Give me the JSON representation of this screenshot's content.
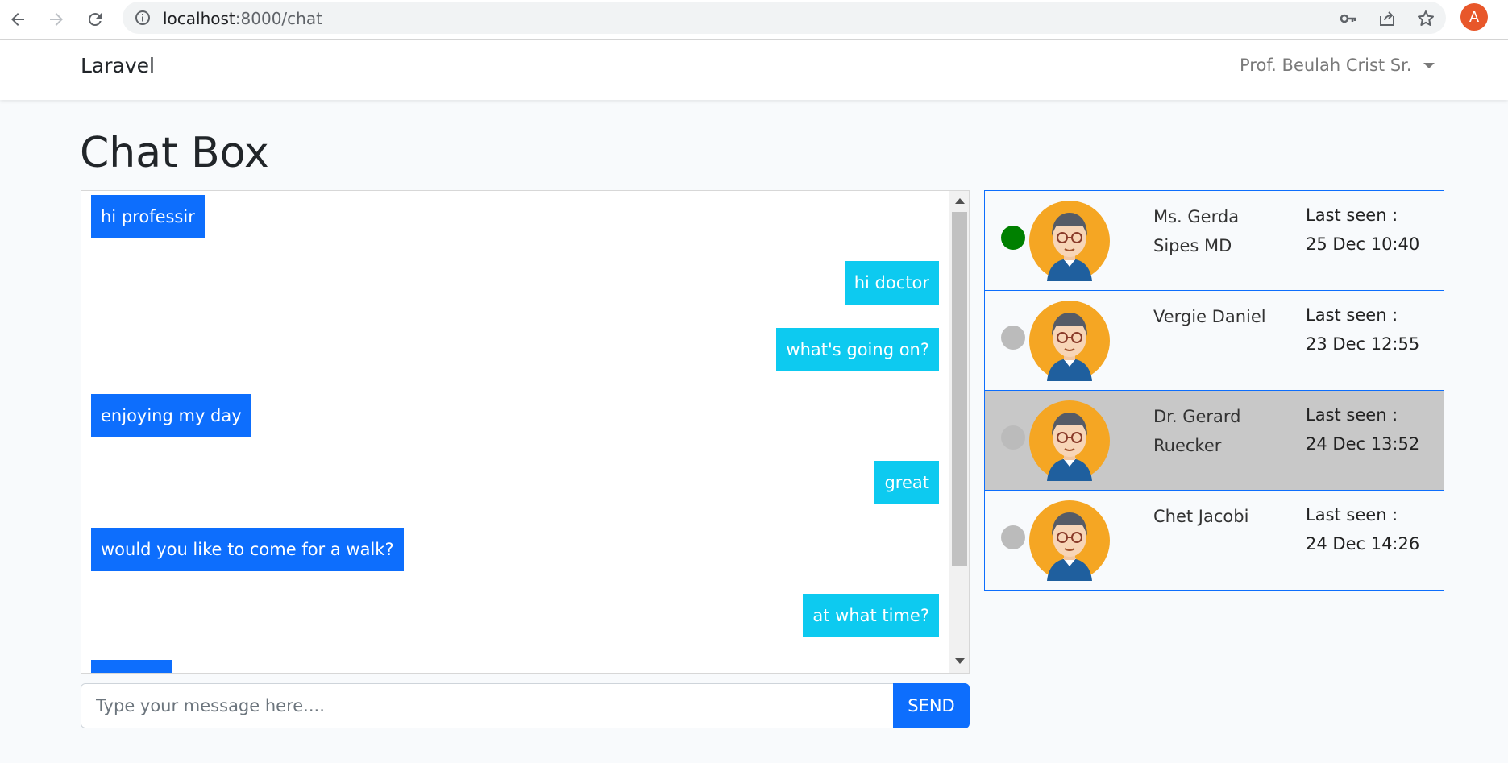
{
  "browser": {
    "url_host": "localhost",
    "url_path": ":8000/chat",
    "profile_initial": "A"
  },
  "navbar": {
    "brand": "Laravel",
    "user_name": "Prof. Beulah Crist Sr."
  },
  "page": {
    "title": "Chat Box"
  },
  "chat": {
    "messages": [
      {
        "text": "hi professir",
        "side": "left"
      },
      {
        "text": "hi doctor",
        "side": "right"
      },
      {
        "text": "what's going on?",
        "side": "right"
      },
      {
        "text": "enjoying my day",
        "side": "left"
      },
      {
        "text": "great",
        "side": "right"
      },
      {
        "text": "would you like to come for a walk?",
        "side": "left"
      },
      {
        "text": "at what time?",
        "side": "right"
      },
      {
        "text": "",
        "side": "left"
      }
    ],
    "input_placeholder": "Type your message here....",
    "send_label": "SEND"
  },
  "users": [
    {
      "name": "Ms. Gerda Sipes MD",
      "last_seen_label": "Last seen :",
      "last_seen": "25 Dec 10:40",
      "online": true,
      "selected": false
    },
    {
      "name": "Vergie Daniel",
      "last_seen_label": "Last seen :",
      "last_seen": "23 Dec 12:55",
      "online": false,
      "selected": false
    },
    {
      "name": "Dr. Gerard Ruecker",
      "last_seen_label": "Last seen :",
      "last_seen": "24 Dec 13:52",
      "online": false,
      "selected": true
    },
    {
      "name": "Chet Jacobi",
      "last_seen_label": "Last seen :",
      "last_seen": "24 Dec 14:26",
      "online": false,
      "selected": false
    }
  ],
  "colors": {
    "primary": "#0d6efd",
    "info": "#0dcaf0",
    "online": "#008000",
    "offline": "#bbbbbb",
    "selected_row": "#c8c8c8"
  }
}
